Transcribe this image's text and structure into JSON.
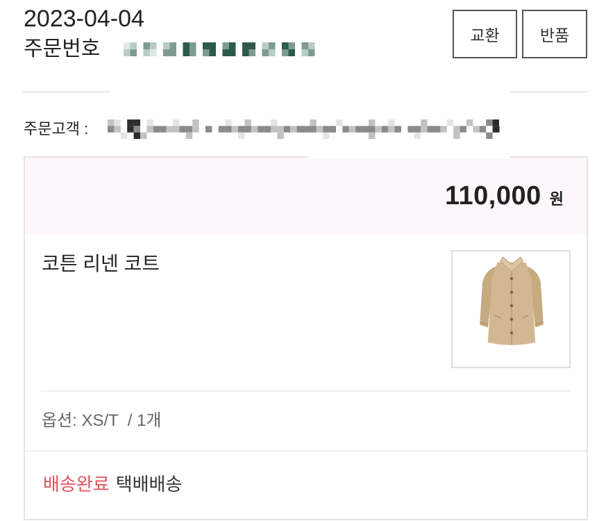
{
  "order": {
    "date": "2023-04-04",
    "number_label": "주문번호"
  },
  "actions": {
    "exchange": "교환",
    "return": "반품"
  },
  "customer": {
    "label": "주문고객 :"
  },
  "item": {
    "price": "110,000",
    "currency": "원",
    "name": "코튼 리넨 코트",
    "thumbnail_icon": "coat-image",
    "option": "옵션: XS/T  / 1개",
    "delivery_status": "배송완료",
    "delivery_method": "택배배송"
  },
  "theme": {
    "status_color": "#e2535d",
    "price_bg": "#fdf6fb",
    "border_color": "#e4e4e4",
    "product_color": "#d2b892"
  }
}
